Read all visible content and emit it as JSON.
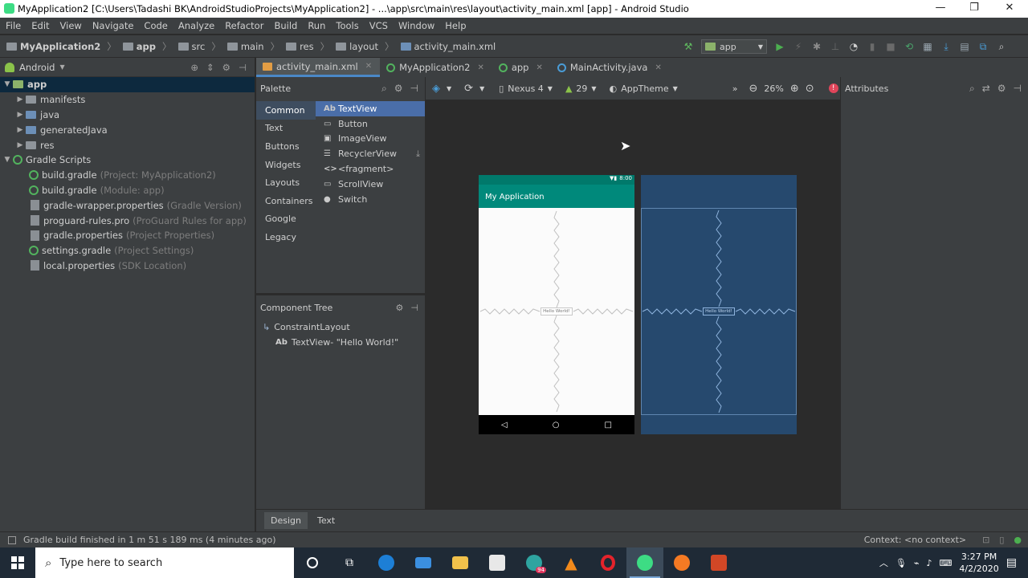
{
  "window": {
    "title": "MyApplication2 [C:\\Users\\Tadashi BK\\AndroidStudioProjects\\MyApplication2] - ...\\app\\src\\main\\res\\layout\\activity_main.xml [app] - Android Studio",
    "minimize": "—",
    "maximize": "❐",
    "close": "✕"
  },
  "menu": [
    "File",
    "Edit",
    "View",
    "Navigate",
    "Code",
    "Analyze",
    "Refactor",
    "Build",
    "Run",
    "Tools",
    "VCS",
    "Window",
    "Help"
  ],
  "breadcrumb": [
    "MyApplication2",
    "app",
    "src",
    "main",
    "res",
    "layout",
    "activity_main.xml"
  ],
  "toolbar": {
    "run_config": "app"
  },
  "project_panel": {
    "view_mode": "Android",
    "tree": [
      {
        "label": "app",
        "hint": "",
        "level": 0
      },
      {
        "label": "manifests",
        "hint": "",
        "level": 1
      },
      {
        "label": "java",
        "hint": "",
        "level": 1
      },
      {
        "label": "generatedJava",
        "hint": "",
        "level": 1
      },
      {
        "label": "res",
        "hint": "",
        "level": 1
      },
      {
        "label": "Gradle Scripts",
        "hint": "",
        "level": 0
      },
      {
        "label": "build.gradle",
        "hint": "(Project: MyApplication2)",
        "level": 1
      },
      {
        "label": "build.gradle",
        "hint": "(Module: app)",
        "level": 1
      },
      {
        "label": "gradle-wrapper.properties",
        "hint": "(Gradle Version)",
        "level": 1
      },
      {
        "label": "proguard-rules.pro",
        "hint": "(ProGuard Rules for app)",
        "level": 1
      },
      {
        "label": "gradle.properties",
        "hint": "(Project Properties)",
        "level": 1
      },
      {
        "label": "settings.gradle",
        "hint": "(Project Settings)",
        "level": 1
      },
      {
        "label": "local.properties",
        "hint": "(SDK Location)",
        "level": 1
      }
    ]
  },
  "editor_tabs": [
    {
      "label": "activity_main.xml",
      "active": true
    },
    {
      "label": "MyApplication2",
      "active": false
    },
    {
      "label": "app",
      "active": false
    },
    {
      "label": "MainActivity.java",
      "active": false
    }
  ],
  "palette": {
    "title": "Palette",
    "categories": [
      "Common",
      "Text",
      "Buttons",
      "Widgets",
      "Layouts",
      "Containers",
      "Google",
      "Legacy"
    ],
    "items": [
      {
        "glyph": "Ab",
        "label": "TextView"
      },
      {
        "glyph": "▭",
        "label": "Button"
      },
      {
        "glyph": "▣",
        "label": "ImageView"
      },
      {
        "glyph": "☰",
        "label": "RecyclerView"
      },
      {
        "glyph": "<>",
        "label": "<fragment>"
      },
      {
        "glyph": "▭",
        "label": "ScrollView"
      },
      {
        "glyph": "●",
        "label": "Switch"
      }
    ]
  },
  "component_tree": {
    "title": "Component Tree",
    "root": "ConstraintLayout",
    "child_glyph": "Ab",
    "child": "TextView",
    "child_hint": "- \"Hello World!\""
  },
  "design_toolbar": {
    "device": "Nexus 4",
    "api": "29",
    "theme": "AppTheme",
    "zoom": "26%"
  },
  "preview": {
    "app_title": "My Application",
    "status_time": "8:00",
    "hello_text": "Hello World!"
  },
  "attributes": {
    "title": "Attributes"
  },
  "bottom_tabs": [
    "Design",
    "Text"
  ],
  "status": {
    "message": "Gradle build finished in 1 m 51 s 189 ms (4 minutes ago)",
    "context": "Context: <no context>"
  },
  "taskbar": {
    "search_placeholder": "Type here to search",
    "time": "3:27 PM",
    "date": "4/2/2020",
    "badge": "94"
  },
  "colors": {
    "ide_bg": "#3c3f41",
    "editor_bg": "#2b2b2b",
    "app_bar": "#00897b",
    "blueprint": "#26496e",
    "selection": "#4a6ea9"
  }
}
